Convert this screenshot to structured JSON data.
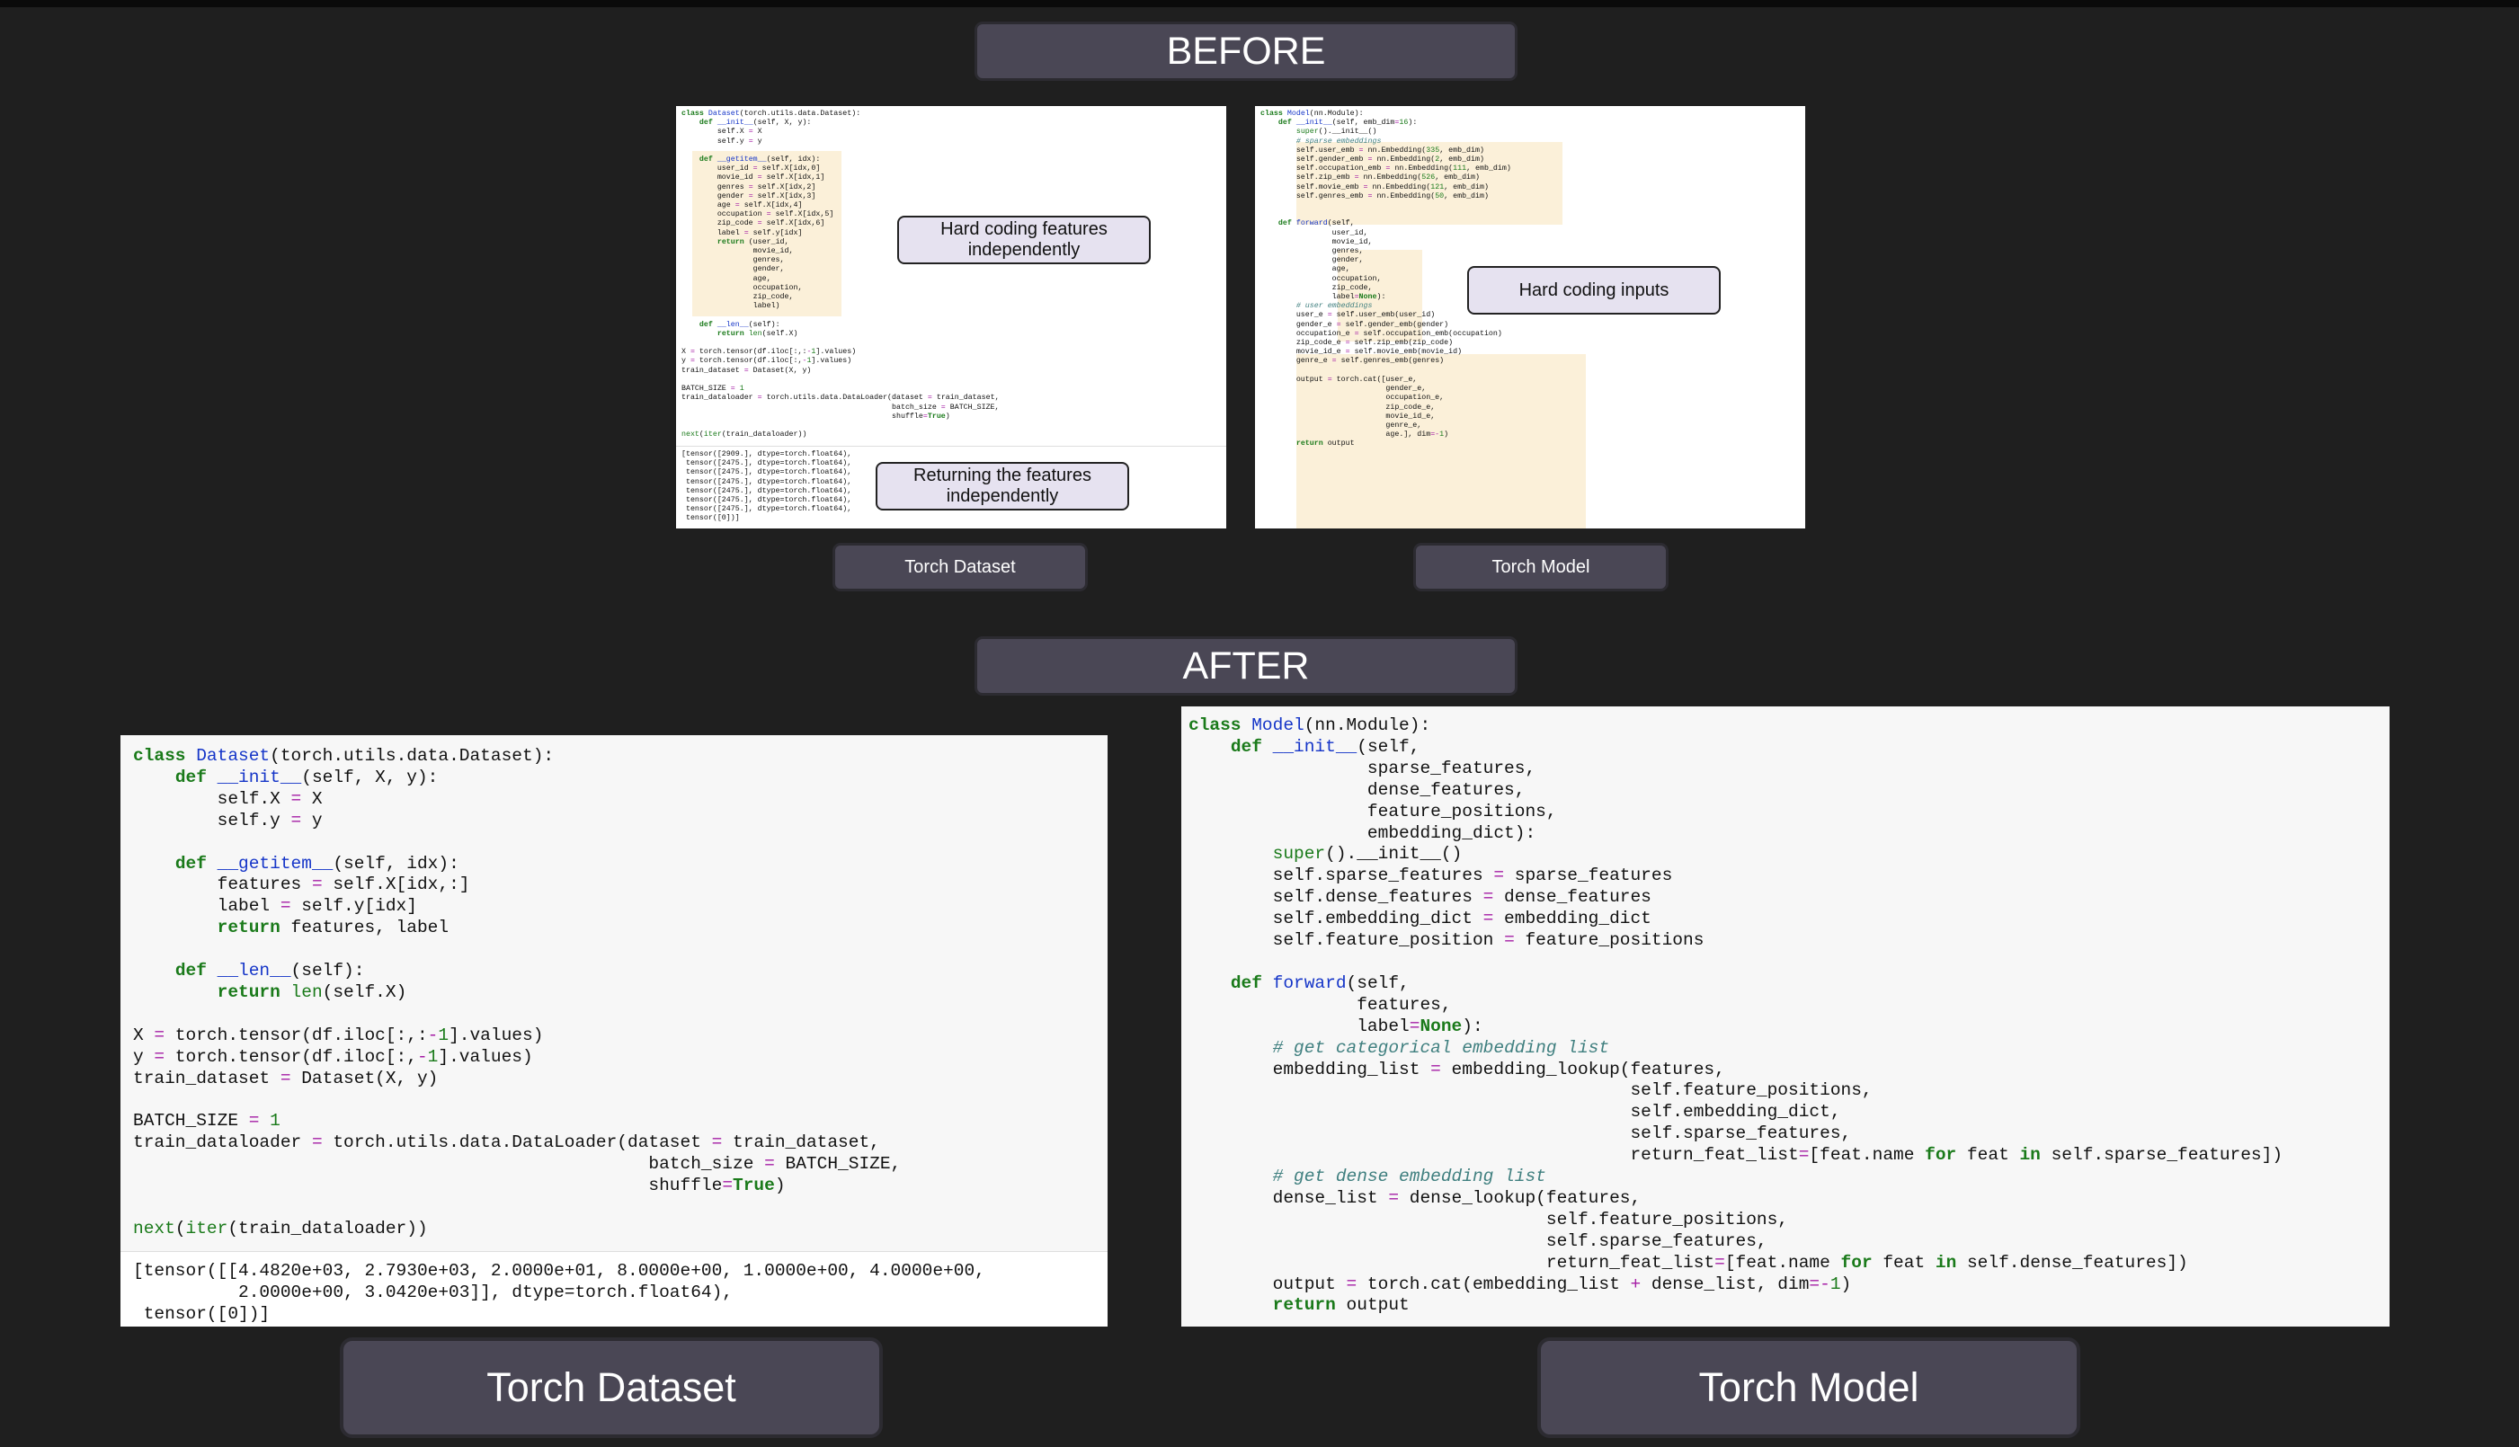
{
  "before_title": "BEFORE",
  "after_title": "AFTER",
  "before": {
    "dataset_caption": "Torch Dataset",
    "model_caption": "Torch Model",
    "dataset_notes": [
      "Hard coding features independently",
      "Returning the features independently"
    ],
    "model_note": "Hard coding inputs"
  },
  "after": {
    "dataset_caption": "Torch Dataset",
    "model_caption": "Torch Model"
  },
  "colors": {
    "background": "#1f1f1f",
    "pill": "#4a4755",
    "note": "#e6e2f0",
    "highlight": "#fbf0d9",
    "keyword": "#1a7a1a",
    "function": "#1535c8",
    "operator": "#a51da5",
    "comment": "#3f7f7f"
  }
}
